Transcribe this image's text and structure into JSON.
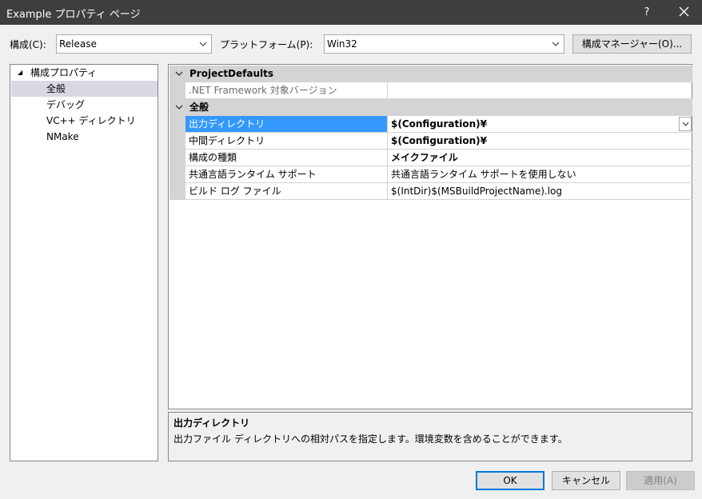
{
  "window": {
    "title": "Example プロパティ ページ",
    "help": "?"
  },
  "toolbar": {
    "config_label": "構成(C):",
    "config_value": "Release",
    "platform_label": "プラットフォーム(P):",
    "platform_value": "Win32",
    "config_manager": "構成マネージャー(O)..."
  },
  "tree": {
    "root": "構成プロパティ",
    "items": [
      "全般",
      "デバッグ",
      "VC++ ディレクトリ",
      "NMake"
    ],
    "selected": "全般"
  },
  "grid": {
    "categories": [
      {
        "name": "ProjectDefaults",
        "rows": [
          {
            "name": ".NET Framework 対象バージョン",
            "value": ""
          }
        ]
      },
      {
        "name": "全般",
        "rows": [
          {
            "name": "出力ディレクトリ",
            "value": "$(Configuration)¥"
          },
          {
            "name": "中間ディレクトリ",
            "value": "$(Configuration)¥"
          },
          {
            "name": "構成の種類",
            "value": "メイクファイル"
          },
          {
            "name": "共通言語ランタイム サポート",
            "value": "共通言語ランタイム サポートを使用しない"
          },
          {
            "name": "ビルド ログ ファイル",
            "value": "$(IntDir)$(MSBuildProjectName).log"
          }
        ]
      }
    ]
  },
  "description": {
    "title": "出力ディレクトリ",
    "text": "出力ファイル ディレクトリへの相対パスを指定します。環境変数を含めることができます。"
  },
  "buttons": {
    "ok": "OK",
    "cancel": "キャンセル",
    "apply": "適用(A)"
  },
  "colors": {
    "titlebar": "#3e3e3e",
    "selection": "#3399ff",
    "primary_border": "#0078d7"
  }
}
